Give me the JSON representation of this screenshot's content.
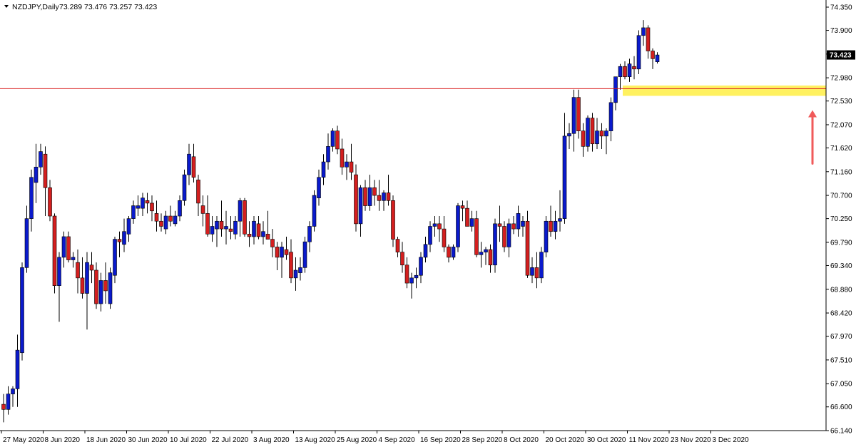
{
  "header": {
    "symbol_timeframe": "NZDJPY,Daily",
    "ohlc_text": "73.289 73.476 73.257 73.423"
  },
  "colors": {
    "bull": "#0a1acc",
    "bear": "#d41f1f",
    "wick": "#000000",
    "level_line": "#d81b1b",
    "zone": "#ffee44",
    "arrow": "#f05a5a",
    "price_tag": "#000000"
  },
  "chart_data": {
    "type": "candlestick",
    "symbol": "NZDJPY",
    "timeframe": "Daily",
    "current_price": "73.423",
    "ylim": [
      66.14,
      74.35
    ],
    "yticks": [
      "74.350",
      "73.900",
      "73.440",
      "72.980",
      "72.530",
      "72.070",
      "71.620",
      "71.160",
      "70.700",
      "70.250",
      "69.790",
      "69.340",
      "68.880",
      "68.420",
      "67.970",
      "67.510",
      "67.050",
      "66.600",
      "66.140"
    ],
    "xticks": [
      "27 May 2020",
      "8 Jun 2020",
      "18 Jun 2020",
      "30 Jun 2020",
      "10 Jul 2020",
      "22 Jul 2020",
      "3 Aug 2020",
      "13 Aug 2020",
      "25 Aug 2020",
      "4 Sep 2020",
      "16 Sep 2020",
      "28 Sep 2020",
      "8 Oct 2020",
      "20 Oct 2020",
      "30 Oct 2020",
      "11 Nov 2020",
      "23 Nov 2020",
      "3 Dec 2020"
    ],
    "xtick_bar_index": [
      0,
      9,
      18,
      27,
      36,
      45,
      54,
      63,
      72,
      81,
      90,
      99,
      108,
      117,
      126,
      135,
      144,
      153
    ],
    "horizontal_level": 72.77,
    "zone": [
      72.63,
      72.83
    ],
    "zone_start_bar": 134,
    "annotation_arrow": "up arrow below zone",
    "ohlc": [
      [
        66.65,
        66.85,
        66.3,
        66.55
      ],
      [
        66.55,
        67.0,
        66.45,
        66.85
      ],
      [
        66.85,
        67.0,
        66.6,
        66.95
      ],
      [
        66.95,
        68.0,
        66.6,
        67.7
      ],
      [
        67.65,
        69.4,
        67.5,
        69.3
      ],
      [
        69.3,
        70.5,
        69.2,
        70.25
      ],
      [
        70.25,
        71.2,
        70.0,
        71.05
      ],
      [
        70.95,
        71.7,
        70.55,
        71.25
      ],
      [
        71.25,
        71.7,
        71.1,
        71.55
      ],
      [
        71.5,
        71.65,
        70.3,
        70.85
      ],
      [
        70.85,
        71.0,
        70.2,
        70.3
      ],
      [
        70.3,
        70.35,
        68.8,
        68.95
      ],
      [
        68.95,
        69.6,
        68.25,
        69.5
      ],
      [
        69.5,
        70.0,
        69.3,
        69.9
      ],
      [
        69.9,
        70.0,
        69.4,
        69.45
      ],
      [
        69.45,
        69.6,
        69.3,
        69.5
      ],
      [
        69.4,
        69.65,
        68.8,
        69.1
      ],
      [
        69.1,
        69.5,
        68.7,
        68.8
      ],
      [
        68.8,
        69.6,
        68.1,
        69.4
      ],
      [
        69.35,
        69.6,
        69.0,
        69.25
      ],
      [
        69.25,
        69.4,
        68.5,
        68.6
      ],
      [
        68.6,
        69.2,
        68.45,
        69.05
      ],
      [
        69.05,
        69.4,
        68.6,
        68.85
      ],
      [
        68.6,
        69.3,
        68.5,
        69.2
      ],
      [
        69.15,
        69.9,
        69.0,
        69.85
      ],
      [
        69.85,
        70.0,
        69.5,
        69.8
      ],
      [
        69.75,
        70.25,
        69.6,
        70.0
      ],
      [
        69.95,
        70.3,
        69.8,
        70.25
      ],
      [
        70.25,
        70.6,
        70.15,
        70.5
      ],
      [
        70.45,
        70.7,
        70.3,
        70.5
      ],
      [
        70.45,
        70.75,
        70.3,
        70.65
      ],
      [
        70.6,
        70.75,
        70.35,
        70.55
      ],
      [
        70.55,
        70.7,
        70.2,
        70.4
      ],
      [
        70.35,
        70.6,
        70.0,
        70.2
      ],
      [
        70.2,
        70.35,
        70.0,
        70.1
      ],
      [
        70.05,
        70.4,
        69.95,
        70.3
      ],
      [
        70.3,
        70.5,
        70.1,
        70.2
      ],
      [
        70.15,
        70.4,
        70.1,
        70.3
      ],
      [
        70.3,
        70.7,
        70.2,
        70.6
      ],
      [
        70.6,
        71.2,
        70.5,
        71.1
      ],
      [
        71.1,
        71.7,
        70.9,
        71.5
      ],
      [
        71.45,
        71.7,
        70.95,
        71.05
      ],
      [
        71.0,
        71.1,
        70.3,
        70.55
      ],
      [
        70.5,
        70.7,
        70.1,
        70.35
      ],
      [
        70.35,
        70.7,
        69.9,
        69.95
      ],
      [
        69.95,
        70.3,
        69.8,
        70.1
      ],
      [
        70.05,
        70.3,
        69.7,
        70.2
      ],
      [
        70.2,
        70.6,
        69.9,
        70.05
      ],
      [
        70.05,
        70.4,
        69.75,
        70.1
      ],
      [
        70.05,
        70.3,
        69.85,
        70.0
      ],
      [
        69.95,
        70.3,
        69.85,
        70.2
      ],
      [
        70.2,
        70.65,
        69.9,
        70.6
      ],
      [
        70.6,
        70.65,
        69.9,
        69.95
      ],
      [
        69.95,
        70.2,
        69.7,
        69.9
      ],
      [
        69.9,
        70.3,
        69.75,
        70.2
      ],
      [
        70.15,
        70.3,
        69.85,
        69.9
      ],
      [
        69.9,
        70.2,
        69.75,
        70.0
      ],
      [
        69.95,
        70.4,
        69.85,
        69.85
      ],
      [
        69.85,
        70.05,
        69.5,
        69.7
      ],
      [
        69.7,
        69.8,
        69.25,
        69.5
      ],
      [
        69.5,
        69.8,
        69.1,
        69.7
      ],
      [
        69.65,
        69.9,
        69.45,
        69.55
      ],
      [
        69.6,
        69.85,
        69.0,
        69.1
      ],
      [
        69.1,
        69.5,
        68.85,
        69.25
      ],
      [
        69.2,
        69.5,
        69.05,
        69.3
      ],
      [
        69.3,
        69.9,
        69.2,
        69.8
      ],
      [
        69.8,
        70.2,
        69.6,
        70.1
      ],
      [
        70.1,
        70.8,
        70.0,
        70.7
      ],
      [
        70.65,
        71.2,
        70.5,
        71.05
      ],
      [
        71.05,
        71.5,
        70.9,
        71.35
      ],
      [
        71.35,
        71.9,
        71.2,
        71.65
      ],
      [
        71.65,
        72.0,
        71.55,
        71.95
      ],
      [
        71.95,
        72.05,
        71.5,
        71.6
      ],
      [
        71.6,
        71.8,
        71.1,
        71.25
      ],
      [
        71.25,
        71.5,
        71.0,
        71.35
      ],
      [
        71.35,
        71.7,
        71.0,
        71.15
      ],
      [
        71.1,
        71.3,
        70.0,
        70.15
      ],
      [
        70.15,
        70.9,
        69.9,
        70.85
      ],
      [
        70.85,
        71.0,
        70.4,
        70.5
      ],
      [
        70.5,
        71.1,
        70.4,
        70.85
      ],
      [
        70.85,
        71.0,
        70.5,
        70.7
      ],
      [
        70.7,
        71.0,
        70.4,
        70.6
      ],
      [
        70.6,
        70.8,
        70.4,
        70.75
      ],
      [
        70.75,
        71.1,
        70.5,
        70.6
      ],
      [
        70.6,
        70.7,
        69.7,
        69.85
      ],
      [
        69.85,
        69.9,
        69.5,
        69.6
      ],
      [
        69.6,
        69.8,
        69.2,
        69.35
      ],
      [
        69.35,
        69.5,
        68.9,
        69.0
      ],
      [
        69.0,
        69.2,
        68.7,
        69.1
      ],
      [
        69.1,
        69.3,
        68.9,
        69.15
      ],
      [
        69.15,
        69.6,
        69.0,
        69.5
      ],
      [
        69.5,
        69.9,
        69.4,
        69.75
      ],
      [
        69.75,
        70.2,
        69.6,
        70.1
      ],
      [
        70.1,
        70.3,
        69.9,
        70.15
      ],
      [
        70.15,
        70.3,
        69.8,
        70.05
      ],
      [
        70.05,
        70.3,
        69.6,
        69.7
      ],
      [
        69.7,
        69.75,
        69.4,
        69.5
      ],
      [
        69.5,
        69.75,
        69.45,
        69.7
      ],
      [
        69.7,
        70.55,
        69.6,
        70.5
      ],
      [
        70.5,
        70.6,
        70.2,
        70.45
      ],
      [
        70.45,
        70.6,
        70.1,
        70.1
      ],
      [
        70.1,
        70.4,
        70.0,
        70.25
      ],
      [
        70.25,
        70.4,
        69.5,
        69.55
      ],
      [
        69.55,
        69.8,
        69.3,
        69.6
      ],
      [
        69.6,
        69.7,
        69.35,
        69.65
      ],
      [
        69.65,
        69.75,
        69.2,
        69.35
      ],
      [
        69.35,
        70.25,
        69.2,
        70.15
      ],
      [
        70.15,
        70.5,
        69.8,
        70.1
      ],
      [
        70.1,
        70.2,
        69.6,
        69.7
      ],
      [
        69.7,
        70.25,
        69.5,
        70.15
      ],
      [
        70.15,
        70.3,
        69.95,
        70.05
      ],
      [
        70.05,
        70.5,
        69.9,
        70.35
      ],
      [
        70.1,
        70.3,
        69.9,
        70.2
      ],
      [
        70.2,
        70.4,
        69.1,
        69.15
      ],
      [
        69.15,
        69.5,
        69.0,
        69.3
      ],
      [
        69.3,
        69.6,
        68.9,
        69.1
      ],
      [
        69.1,
        69.7,
        69.0,
        69.6
      ],
      [
        69.6,
        70.3,
        69.5,
        70.2
      ],
      [
        70.2,
        70.5,
        69.9,
        70.0
      ],
      [
        70.0,
        70.4,
        69.85,
        70.2
      ],
      [
        70.2,
        70.8,
        70.0,
        70.25
      ],
      [
        70.25,
        72.3,
        70.15,
        71.85
      ],
      [
        71.85,
        72.1,
        71.6,
        71.9
      ],
      [
        71.9,
        72.75,
        71.55,
        72.6
      ],
      [
        72.6,
        72.75,
        71.8,
        71.95
      ],
      [
        71.95,
        72.1,
        71.45,
        71.65
      ],
      [
        71.65,
        72.25,
        71.55,
        72.2
      ],
      [
        72.2,
        72.3,
        71.55,
        71.7
      ],
      [
        71.7,
        72.2,
        71.6,
        71.95
      ],
      [
        71.95,
        72.1,
        71.6,
        71.85
      ],
      [
        71.85,
        72.0,
        71.5,
        71.95
      ],
      [
        71.95,
        72.6,
        71.75,
        72.5
      ],
      [
        72.5,
        73.0,
        72.35,
        73.0
      ],
      [
        73.0,
        73.25,
        72.75,
        73.2
      ],
      [
        73.2,
        73.3,
        72.95,
        73.0
      ],
      [
        73.0,
        73.35,
        72.9,
        73.25
      ],
      [
        73.2,
        73.4,
        72.95,
        73.15
      ],
      [
        73.15,
        73.9,
        73.05,
        73.8
      ],
      [
        73.8,
        74.1,
        73.6,
        73.95
      ],
      [
        73.95,
        74.0,
        73.35,
        73.5
      ],
      [
        73.5,
        73.55,
        73.15,
        73.35
      ],
      [
        73.29,
        73.476,
        73.257,
        73.423
      ]
    ]
  }
}
